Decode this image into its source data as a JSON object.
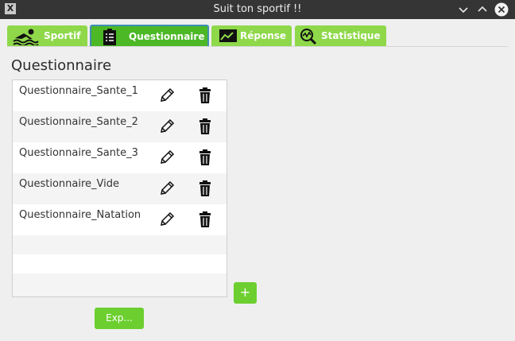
{
  "window": {
    "title": "Suit ton sportif !!"
  },
  "tabs": [
    {
      "label": "Sportif",
      "icon": "swimmer-icon"
    },
    {
      "label": "Questionnaire",
      "icon": "clipboard-icon"
    },
    {
      "label": "Réponse",
      "icon": "mail-icon"
    },
    {
      "label": "Statistique",
      "icon": "stats-magnifier-icon"
    }
  ],
  "main": {
    "heading": "Questionnaire",
    "items": [
      {
        "name": "Questionnaire_Sante_1"
      },
      {
        "name": "Questionnaire_Sante_2"
      },
      {
        "name": "Questionnaire_Sante_3"
      },
      {
        "name": "Questionnaire_Vide"
      },
      {
        "name": "Questionnaire_Natation"
      }
    ],
    "add_label": "+",
    "export_label": "Exp..."
  },
  "colors": {
    "tab": "#8ed84a",
    "tab_active": "#4cb826",
    "button": "#6ccf2f",
    "titlebar": "#353535"
  }
}
